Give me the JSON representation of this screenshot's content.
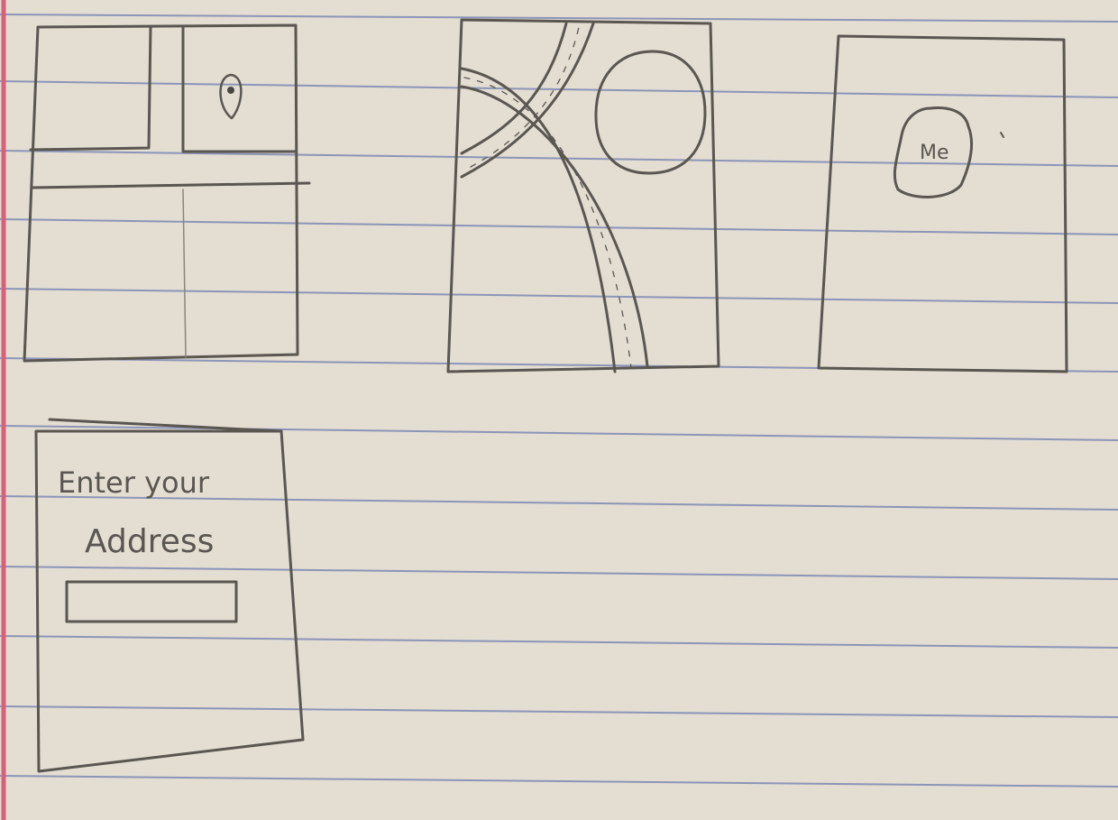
{
  "paper": {
    "background": "#e3ddd2",
    "rule_color": "#8c95b8",
    "margin_color": "#d9607a",
    "pencil_color": "#5a5650"
  },
  "sketches": {
    "sketch_1": {
      "pin_icon": "map-pin-icon"
    },
    "sketch_2": {
      "content": "map-with-roads"
    },
    "sketch_3": {
      "badge_label": "Me"
    },
    "sketch_4": {
      "heading_line1": "Enter your",
      "heading_line2": "Address"
    }
  }
}
